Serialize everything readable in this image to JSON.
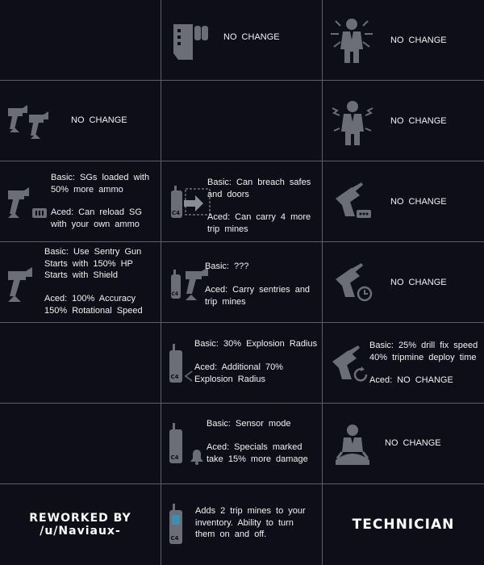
{
  "colors": {
    "background": "#0d0e18",
    "grid_line": "#5c5e66",
    "icon": "#6b6e76",
    "text": "#f2f2f2"
  },
  "cells": {
    "r1c2": {
      "icon": "ammo-bag-icon",
      "text": "NO CHANGE"
    },
    "r1c3": {
      "icon": "electrified-suit-icon",
      "text": "NO CHANGE"
    },
    "r2c1": {
      "icon": "dual-sentry-guns-icon",
      "text": "NO CHANGE"
    },
    "r2c3": {
      "icon": "shocked-suit-icon",
      "text": "NO CHANGE"
    },
    "r3c1": {
      "icon": "sentry-ammo-icon",
      "basic": "Basic: SGs loaded with\n50% more ammo",
      "aced": "Aced: Can reload SG\nwith your own ammo"
    },
    "r3c2": {
      "icon": "c4-breach-icon",
      "basic": "Basic: Can breach safes\nand doors",
      "aced": "Aced: Can carry 4 more\ntrip mines"
    },
    "r3c3": {
      "icon": "drill-upgrade-icon",
      "text": "NO CHANGE"
    },
    "r4c1": {
      "icon": "sentry-gun-icon",
      "text": "Basic: Use Sentry Gun\nStarts with 150% HP\nStarts with Shield\n\nAced: 100% Accuracy\n150% Rotational Speed"
    },
    "r4c2": {
      "icon": "c4-sentry-icon",
      "basic": "Basic: ???",
      "aced": "Aced: Carry sentries and\ntrip mines"
    },
    "r4c3": {
      "icon": "drill-timer-icon",
      "text": "NO CHANGE"
    },
    "r5c2": {
      "icon": "c4-blast-icon",
      "basic": "Basic: 30% Explosion Radius",
      "aced": "Aced: Additional 70%\nExplosion Radius"
    },
    "r5c3": {
      "icon": "drill-repair-icon",
      "basic": "Basic: 25% drill fix speed\n40% tripmine deploy time",
      "aced": "Aced: NO CHANGE"
    },
    "r6c2": {
      "icon": "c4-alarm-icon",
      "basic": "Basic: Sensor mode",
      "aced": "Aced: Specials marked\ntake 15% more damage"
    },
    "r6c3": {
      "icon": "meditating-suit-icon",
      "text": "NO CHANGE"
    },
    "r7c1": {
      "text": "REWORKED BY\n/u/Naviaux-"
    },
    "r7c2": {
      "icon": "trip-mine-icon",
      "text": "Adds 2 trip mines to your\ninventory. Ability to turn\nthem on and off."
    },
    "r7c3": {
      "text": "TECHNICIAN"
    }
  }
}
